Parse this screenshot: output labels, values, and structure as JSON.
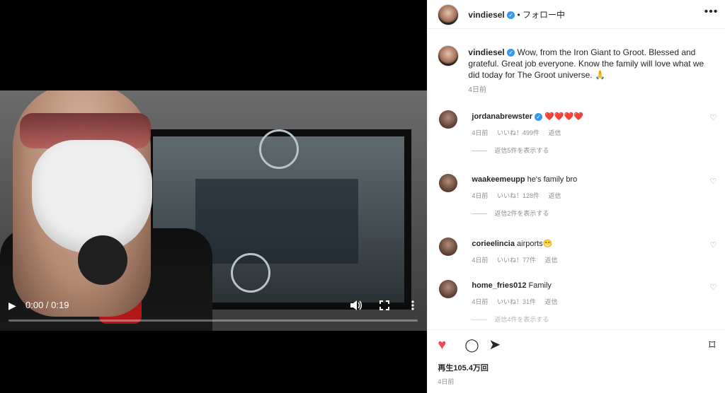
{
  "video": {
    "play_icon": "▶",
    "time": "0:00 / 0:19",
    "volume_icon": "volume-icon",
    "fullscreen_icon": "fullscreen-icon",
    "menu_icon": "more-vert-icon",
    "progress": 0.0
  },
  "header": {
    "username": "vindiesel",
    "verified_glyph": "✓",
    "follow_status": "• フォロー中",
    "more": "•••"
  },
  "caption": {
    "username": "vindiesel",
    "text": "Wow, from the Iron Giant to Groot. Blessed and grateful. Great job everyone. Know the family will love what we did today for The Groot universe. 🙏",
    "time": "4日前"
  },
  "comments": [
    {
      "user": "jordanabrewster",
      "text": "❤️❤️❤️❤️",
      "time": "4日前",
      "likes": "いいね！499件",
      "reply": "返信",
      "replies": "返信5件を表示する"
    },
    {
      "user": "waakeemeupp",
      "text": "he's family bro",
      "time": "4日前",
      "likes": "いいね！128件",
      "reply": "返信",
      "replies": "返信2件を表示する"
    },
    {
      "user": "corieelincia",
      "text": "airports😁",
      "time": "4日前",
      "likes": "いいね！77件",
      "reply": "返信"
    },
    {
      "user": "home_fries012",
      "text": "Family",
      "time": "4日前",
      "likes": "いいね！31件",
      "reply": "返信",
      "replies": "返信4件を表示する"
    }
  ],
  "actions": {
    "like": "♥",
    "comment": "◯",
    "share": "➤",
    "save": "⌑"
  },
  "stats": {
    "views": "再生105.4万回",
    "date": "4日前"
  },
  "colors": {
    "like_red": "#ed4956",
    "verified_blue": "#3897f0"
  }
}
